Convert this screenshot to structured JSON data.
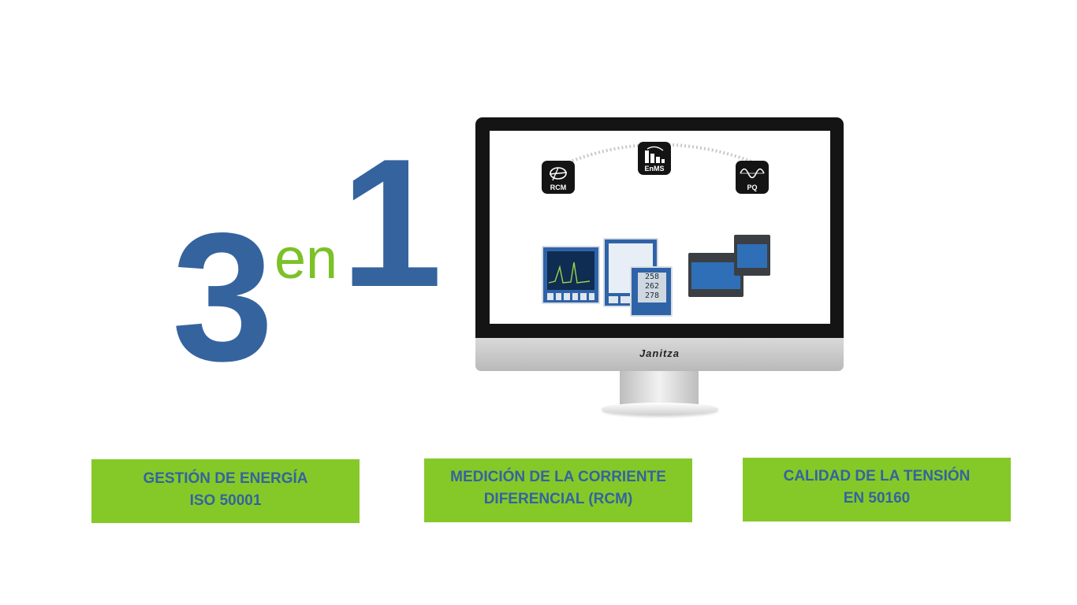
{
  "headline": {
    "number_left": "3",
    "connector": "en",
    "number_right": "1"
  },
  "monitor": {
    "brand": "Janitza",
    "icons": [
      {
        "label": "RCM",
        "icon": "rcm-sensor-icon"
      },
      {
        "label": "EnMS",
        "icon": "energy-bars-icon"
      },
      {
        "label": "PQ",
        "icon": "sine-wave-icon"
      }
    ],
    "lcd_lines": [
      "258",
      "262",
      "278"
    ]
  },
  "features": [
    {
      "line1": "GESTIÓN DE ENERGÍA",
      "line2": "ISO 50001"
    },
    {
      "line1": "MEDICIÓN DE LA CORRIENTE",
      "line2": "DIFERENCIAL (RCM)"
    },
    {
      "line1": "CALIDAD DE LA TENSIÓN",
      "line2": "EN 50160"
    }
  ],
  "colors": {
    "blue": "#35639e",
    "green": "#7cc128",
    "box_green": "#85c928"
  }
}
